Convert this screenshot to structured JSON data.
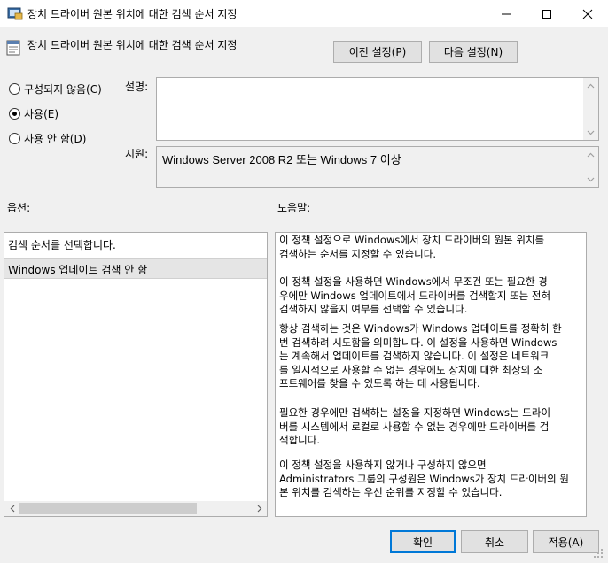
{
  "window": {
    "title": "장치 드라이버 원본 위치에 대한 검색 순서 지정",
    "controls": [
      "minimize-icon",
      "maximize-icon",
      "close-icon"
    ]
  },
  "header": {
    "policy_title": "장치 드라이버 원본 위치에 대한 검색 순서 지정",
    "prev_button": "이전 설정(P)",
    "next_button": "다음 설정(N)"
  },
  "state_options": [
    {
      "label": "구성되지 않음(C)",
      "checked": false
    },
    {
      "label": "사용(E)",
      "checked": true
    },
    {
      "label": "사용 안 함(D)",
      "checked": false
    }
  ],
  "comment": {
    "label": "설명:",
    "value": ""
  },
  "supported": {
    "label": "지원:",
    "value": "Windows Server 2008 R2 또는 Windows 7 이상"
  },
  "options": {
    "label": "옵션:",
    "description": "검색 순서를 선택합니다.",
    "selected_value": "Windows 업데이트 검색 안 함"
  },
  "help": {
    "label": "도움말:",
    "paragraphs": [
      [
        "이 정책 설정으로 Windows에서 장치 드라이버의 원본 위치를",
        "검색하는 순서를 지정할 수 있습니다."
      ],
      [
        "이 정책 설정을 사용하면 Windows에서 무조건 또는 필요한 경",
        "우에만 Windows 업데이트에서 드라이버를 검색할지 또는 전혀",
        "검색하지 않을지 여부를 선택할 수 있습니다."
      ],
      [
        "항상 검색하는 것은 Windows가 Windows 업데이트를 정확히 한",
        "번 검색하려 시도함을 의미합니다. 이 설정을 사용하면 Windows",
        "는 계속해서 업데이트를 검색하지 않습니다. 이 설정은 네트워크",
        "를 일시적으로 사용할 수 없는 경우에도 장치에 대한 최상의 소",
        "프트웨어를 찾을 수 있도록 하는 데 사용됩니다."
      ],
      [
        "필요한 경우에만 검색하는 설정을 지정하면 Windows는 드라이",
        "버를 시스템에서 로컬로 사용할 수 없는 경우에만 드라이버를 검",
        "색합니다."
      ],
      [
        "이 정책 설정을 사용하지 않거나 구성하지 않으면",
        "Administrators 그룹의 구성원은 Windows가 장치 드라이버의 원",
        "본 위치를 검색하는 우선 순위를 지정할 수 있습니다."
      ]
    ]
  },
  "footer": {
    "ok": "확인",
    "cancel": "취소",
    "apply": "적용(A)"
  }
}
